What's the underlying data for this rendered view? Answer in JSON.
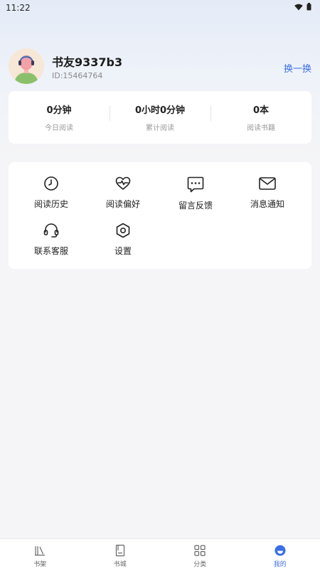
{
  "status_bar": {
    "time": "11:22"
  },
  "profile": {
    "username": "书友9337b3",
    "user_id": "ID:15464764",
    "switch_label": "换一换"
  },
  "stats": [
    {
      "value": "0分钟",
      "label": "今日阅读"
    },
    {
      "value": "0小时0分钟",
      "label": "累计阅读"
    },
    {
      "value": "0本",
      "label": "阅读书籍"
    }
  ],
  "menu": [
    {
      "label": "阅读历史",
      "icon": "clock-icon"
    },
    {
      "label": "阅读偏好",
      "icon": "heart-pulse-icon"
    },
    {
      "label": "留言反馈",
      "icon": "chat-bubble-icon"
    },
    {
      "label": "消息通知",
      "icon": "mail-icon"
    },
    {
      "label": "联系客服",
      "icon": "headset-icon"
    },
    {
      "label": "设置",
      "icon": "settings-hex-icon"
    }
  ],
  "tabbar": [
    {
      "label": "书架",
      "icon": "bookshelf-icon"
    },
    {
      "label": "书城",
      "icon": "book-icon"
    },
    {
      "label": "分类",
      "icon": "grid-icon"
    },
    {
      "label": "我的",
      "icon": "profile-icon"
    }
  ],
  "colors": {
    "accent": "#3a6fe6",
    "background": "#f5f5f7",
    "card": "#ffffff"
  }
}
